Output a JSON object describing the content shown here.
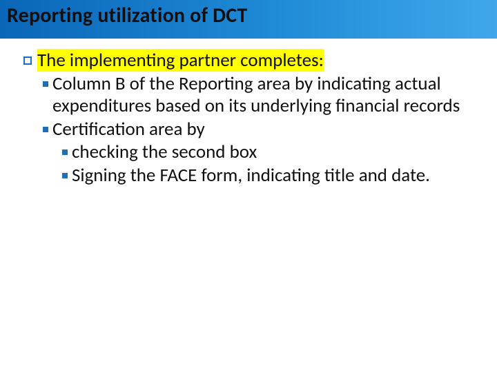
{
  "slide": {
    "title": "Reporting utilization of DCT",
    "l1": "The implementing partner completes:",
    "l2a": "Column B of the Reporting area by indicating actual expenditures based on its underlying financial records",
    "l2b": "Certification area by",
    "l3a": "checking the second box",
    "l3b": "Signing the FACE form, indicating title and date."
  }
}
